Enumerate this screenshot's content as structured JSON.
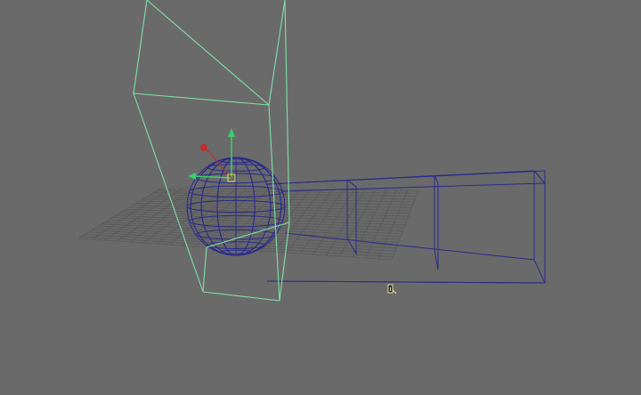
{
  "viewport": {
    "background": "#6a6a6a",
    "grid_color": "#5a5a5a",
    "selection_color": "#7fe0a8",
    "wire_color": "#2a2a8c",
    "axis_y_color": "#38d06a",
    "axis_x_color": "#d03030",
    "axis_z_color": "#38d06a"
  },
  "scene": {
    "objects": [
      {
        "name": "sphere",
        "state": "unselected",
        "display": "wireframe"
      },
      {
        "name": "tall-box",
        "state": "selected",
        "display": "wireframe"
      },
      {
        "name": "long-box",
        "state": "unselected",
        "display": "wireframe"
      },
      {
        "name": "ground-grid",
        "state": "unselected",
        "display": "grid"
      }
    ],
    "manipulator": "move-tool",
    "cursor_icon": "move-cursor-icon"
  }
}
